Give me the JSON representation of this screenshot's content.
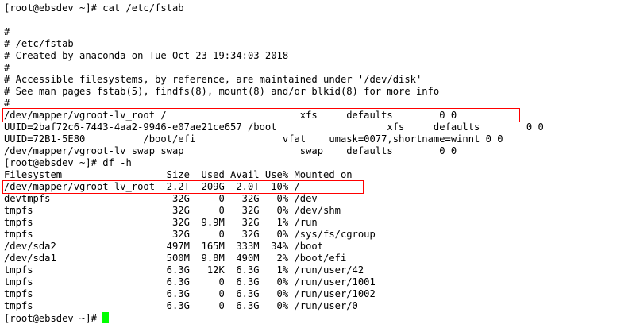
{
  "terminal": {
    "lines": [
      "[root@ebsdev ~]# cat /etc/fstab",
      "",
      "#",
      "# /etc/fstab",
      "# Created by anaconda on Tue Oct 23 19:34:03 2018",
      "#",
      "# Accessible filesystems, by reference, are maintained under '/dev/disk'",
      "# See man pages fstab(5), findfs(8), mount(8) and/or blkid(8) for more info",
      "#",
      "/dev/mapper/vgroot-lv_root /                       xfs     defaults        0 0",
      "UUID=2baf72c6-7443-4aa2-9946-e07ae21ce657 /boot                   xfs     defaults        0 0",
      "UUID=72B1-5E80          /boot/efi               vfat    umask=0077,shortname=winnt 0 0",
      "/dev/mapper/vgroot-lv_swap swap                    swap    defaults        0 0",
      "[root@ebsdev ~]# df -h",
      "Filesystem                  Size  Used Avail Use% Mounted on",
      "/dev/mapper/vgroot-lv_root  2.2T  209G  2.0T  10% /",
      "devtmpfs                     32G     0   32G   0% /dev",
      "tmpfs                        32G     0   32G   0% /dev/shm",
      "tmpfs                        32G  9.9M   32G   1% /run",
      "tmpfs                        32G     0   32G   0% /sys/fs/cgroup",
      "/dev/sda2                   497M  165M  333M  34% /boot",
      "/dev/sda1                   500M  9.8M  490M   2% /boot/efi",
      "tmpfs                       6.3G   12K  6.3G   1% /run/user/42",
      "tmpfs                       6.3G     0  6.3G   0% /run/user/1001",
      "tmpfs                       6.3G     0  6.3G   0% /run/user/1002",
      "tmpfs                       6.3G     0  6.3G   0% /run/user/0"
    ],
    "prompt": "[root@ebsdev ~]# ",
    "cursor_color": "#00ff00",
    "highlight_color": "#ff0000",
    "background_color": "#ffffff",
    "text_color": "#000000"
  }
}
